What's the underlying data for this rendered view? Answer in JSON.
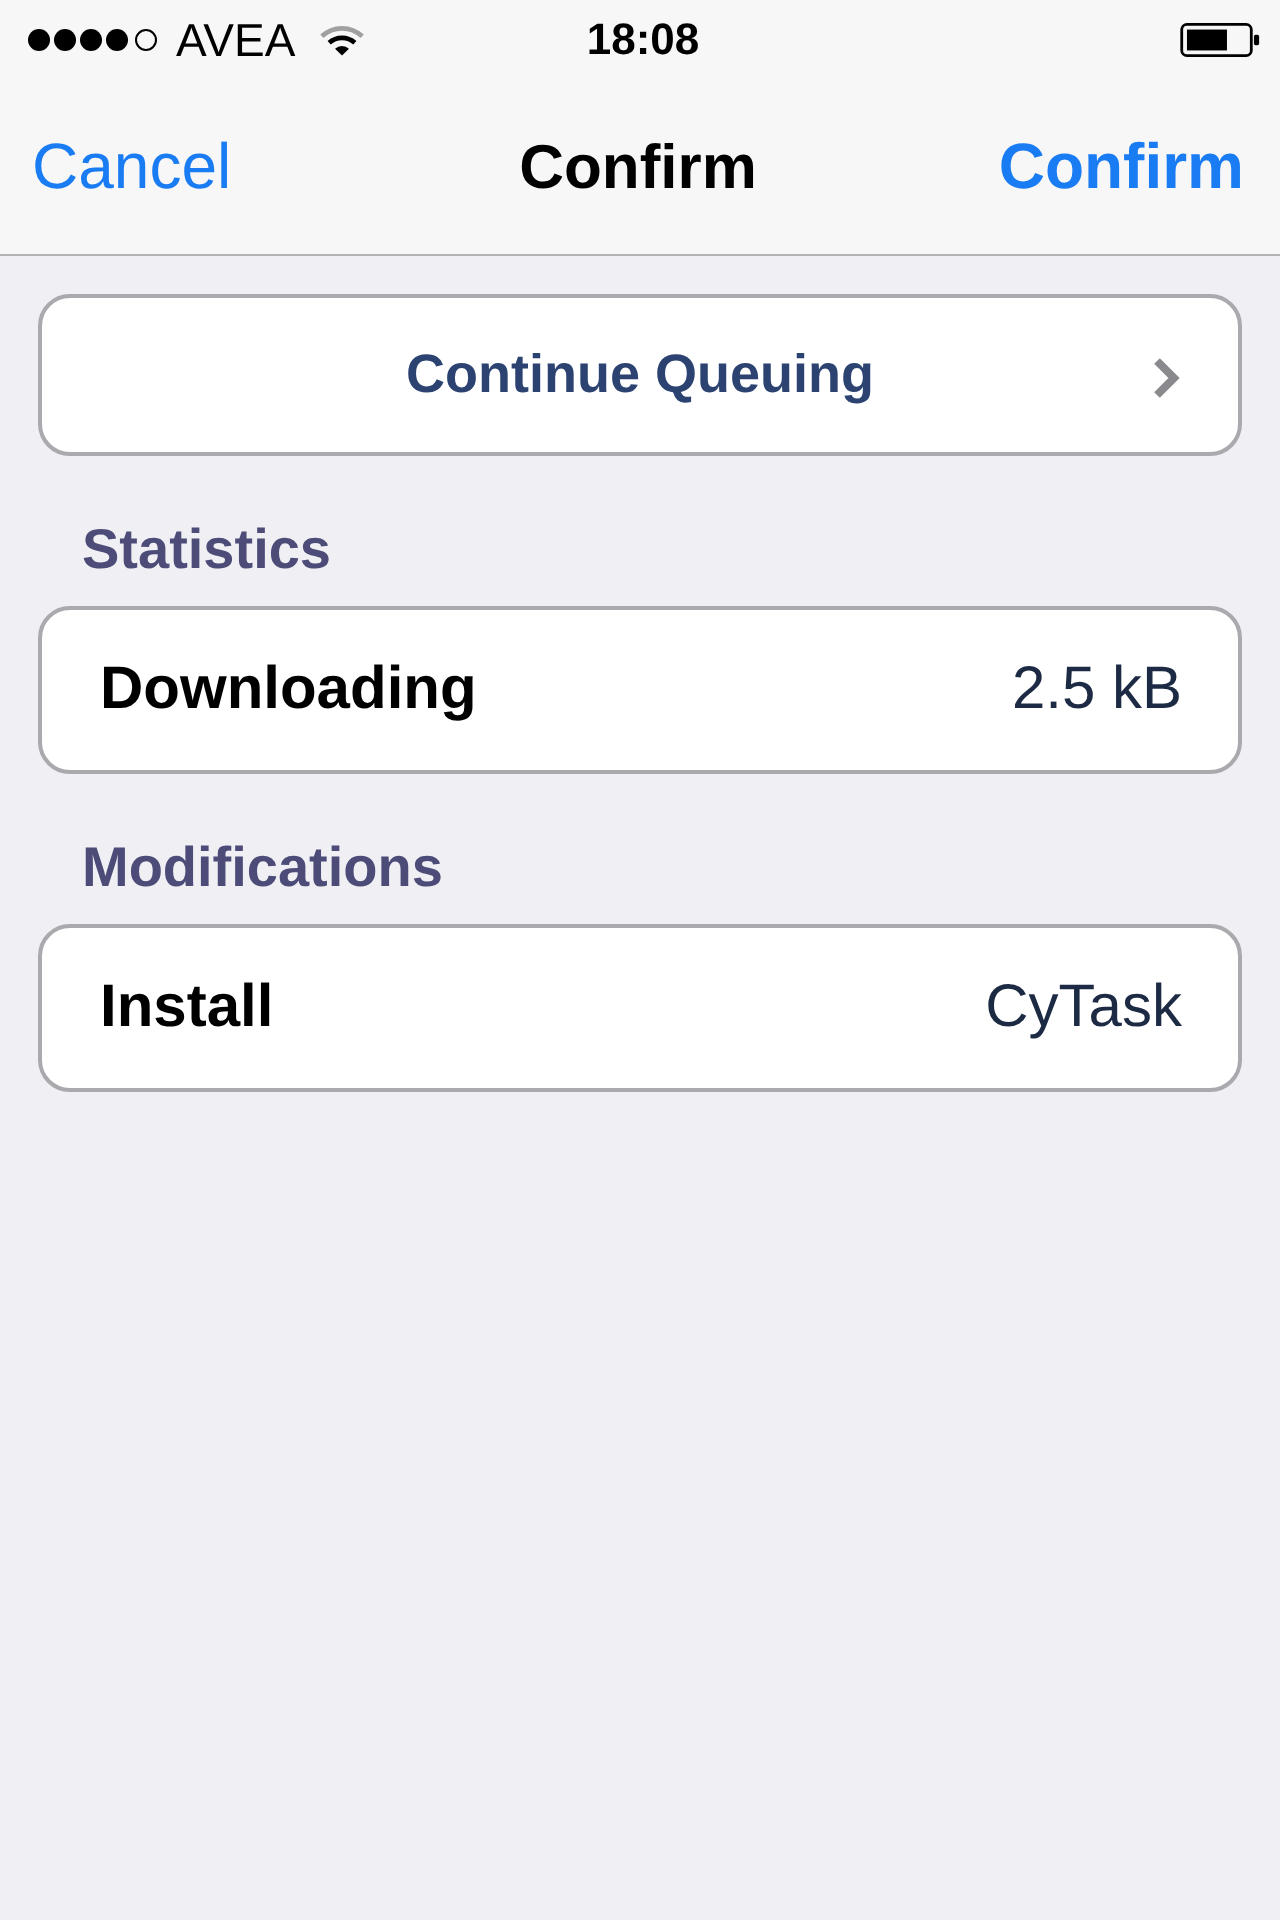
{
  "status_bar": {
    "carrier": "AVEA",
    "time": "18:08"
  },
  "nav_bar": {
    "left_button": "Cancel",
    "title": "Confirm",
    "right_button": "Confirm"
  },
  "action": {
    "label": "Continue Queuing"
  },
  "sections": [
    {
      "header": "Statistics",
      "rows": [
        {
          "label": "Downloading",
          "value": "2.5 kB"
        }
      ]
    },
    {
      "header": "Modifications",
      "rows": [
        {
          "label": "Install",
          "value": "CyTask"
        }
      ]
    }
  ]
}
